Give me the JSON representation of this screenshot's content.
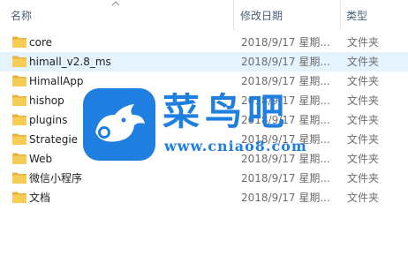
{
  "columns": {
    "name": "名称",
    "date": "修改日期",
    "type": "类型"
  },
  "icons": {
    "sort": "chevron-up-icon",
    "folder": "folder-icon"
  },
  "colors": {
    "folder": "#f3c94b",
    "hover_row": "#e5f3ff",
    "watermark": "#1f7fe0"
  },
  "files": [
    {
      "name": "core",
      "date": "2018/9/17 星期...",
      "type": "文件夹"
    },
    {
      "name": "himall_v2.8_ms",
      "date": "2018/9/17 星期...",
      "type": "文件夹"
    },
    {
      "name": "HimallApp",
      "date": "2018/9/17 星期...",
      "type": "文件夹"
    },
    {
      "name": "hishop",
      "date": "2018/9/17 星期...",
      "type": "文件夹"
    },
    {
      "name": "plugins",
      "date": "2018/9/17 星期...",
      "type": "文件夹"
    },
    {
      "name": "Strategie",
      "date": "2018/9/17 星期...",
      "type": "文件夹"
    },
    {
      "name": "Web",
      "date": "2018/9/17 星期...",
      "type": "文件夹"
    },
    {
      "name": "微信小程序",
      "date": "2018/9/17 星期...",
      "type": "文件夹"
    },
    {
      "name": "文档",
      "date": "2018/9/17 星期...",
      "type": "文件夹"
    }
  ],
  "watermark": {
    "title": "菜鸟吧",
    "url": "www.cniao8.com"
  }
}
